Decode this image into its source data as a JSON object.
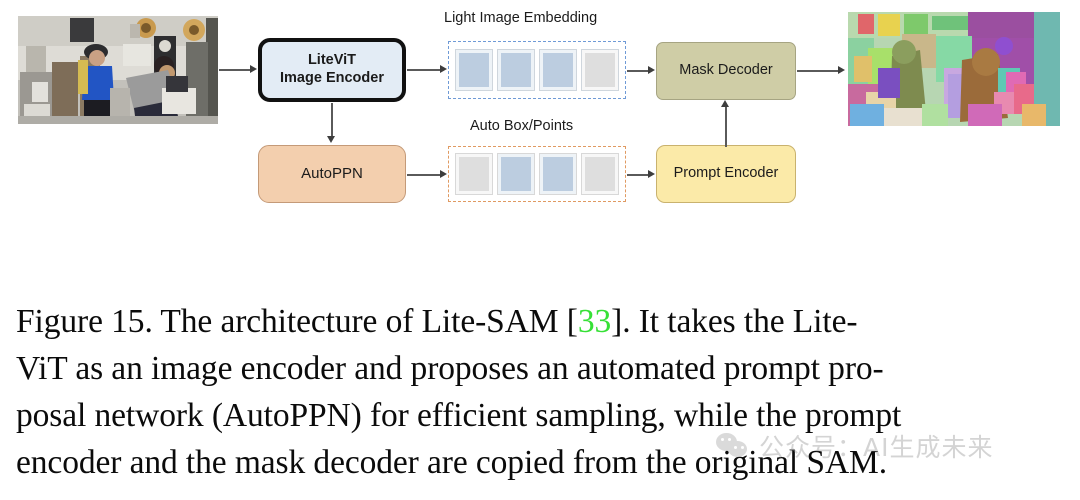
{
  "figure": {
    "nodes": {
      "image_encoder": "LiteViT\nImage Encoder",
      "image_encoder_line1": "LiteViT",
      "image_encoder_line2": "Image Encoder",
      "autoppn": "AutoPPN",
      "mask_decoder": "Mask Decoder",
      "prompt_encoder": "Prompt Encoder"
    },
    "group_labels": {
      "embedding": "Light Image Embedding",
      "prompts": "Auto Box/Points"
    },
    "tokens": {
      "embedding": [
        "blue",
        "blue",
        "blue",
        "gray"
      ],
      "prompts": [
        "gray",
        "blue",
        "blue",
        "gray"
      ]
    },
    "images": {
      "input_alt": "surveillance photo of people working in a workshop",
      "output_alt": "same photo with colorful segmentation masks overlaid"
    },
    "colors": {
      "image_encoder_fill": "#e3ecf5",
      "image_encoder_border": "#111111",
      "autoppn_fill": "#f3cfae",
      "mask_decoder_fill": "#cfcda6",
      "prompt_encoder_fill": "#fbeaa8",
      "embedding_dash": "#6f9ad6",
      "prompts_dash": "#e09a62",
      "token_blue": "#bccde0",
      "token_gray": "#dedede",
      "citation_green": "#36e036"
    }
  },
  "caption": {
    "lines": [
      {
        "before": "Figure 15.  The architecture of Lite-SAM [",
        "cite": "33",
        "after": "].  It takes the Lite-"
      },
      {
        "before": "ViT as an image encoder and proposes an automated prompt pro-",
        "cite": "",
        "after": ""
      },
      {
        "before": "posal network (AutoPPN) for efficient sampling, while the prompt",
        "cite": "",
        "after": ""
      },
      {
        "before": "encoder and the mask decoder are copied from the original SAM.",
        "cite": "",
        "after": ""
      }
    ],
    "figure_number": "Figure 15.",
    "citation": "33"
  },
  "watermark": {
    "text": "公众号：AI生成未来",
    "icon": "wechat-icon"
  }
}
